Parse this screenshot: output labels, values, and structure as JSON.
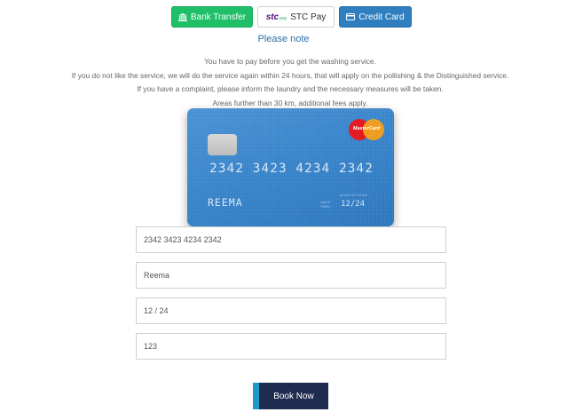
{
  "payment_tabs": {
    "bank_transfer": "Bank Transfer",
    "stc_logo": "stc",
    "stc_logo_sub": "pay",
    "stc_pay": "STC Pay",
    "credit_card": "Credit Card"
  },
  "note": {
    "title": "Please note",
    "lines": [
      "You have to pay before you get the washing service.",
      "If you do not like the service, we will do the service again within 24 hours, that will apply on the pollishing & the Distinguished service.",
      "If you have a complaint, please inform the laundry and the necessary measures will be taken.",
      "Areas further than 30 km, additional fees apply."
    ]
  },
  "card": {
    "brand": "MasterCard",
    "number": "2342 3423 4234 2342",
    "name": "REEMA",
    "valid_line1": "VALID",
    "valid_line2": "THRU",
    "mm_yy": "MONTH/YEAR",
    "expiry": "12/24"
  },
  "form": {
    "card_number": "2342 3423 4234 2342",
    "card_name": "Reema",
    "expiry": "12 / 24",
    "cvc": "123"
  },
  "submit_label": "Book Now",
  "colors": {
    "bank_transfer_bg": "#1fbf68",
    "credit_card_bg": "#2f7fc0",
    "note_title": "#2e6fa8",
    "book_button_bg": "#1e2c4f",
    "book_button_accent": "#1a9bc6"
  },
  "icons": {
    "bank_transfer": "bank-icon",
    "credit_card": "credit-card-icon"
  }
}
